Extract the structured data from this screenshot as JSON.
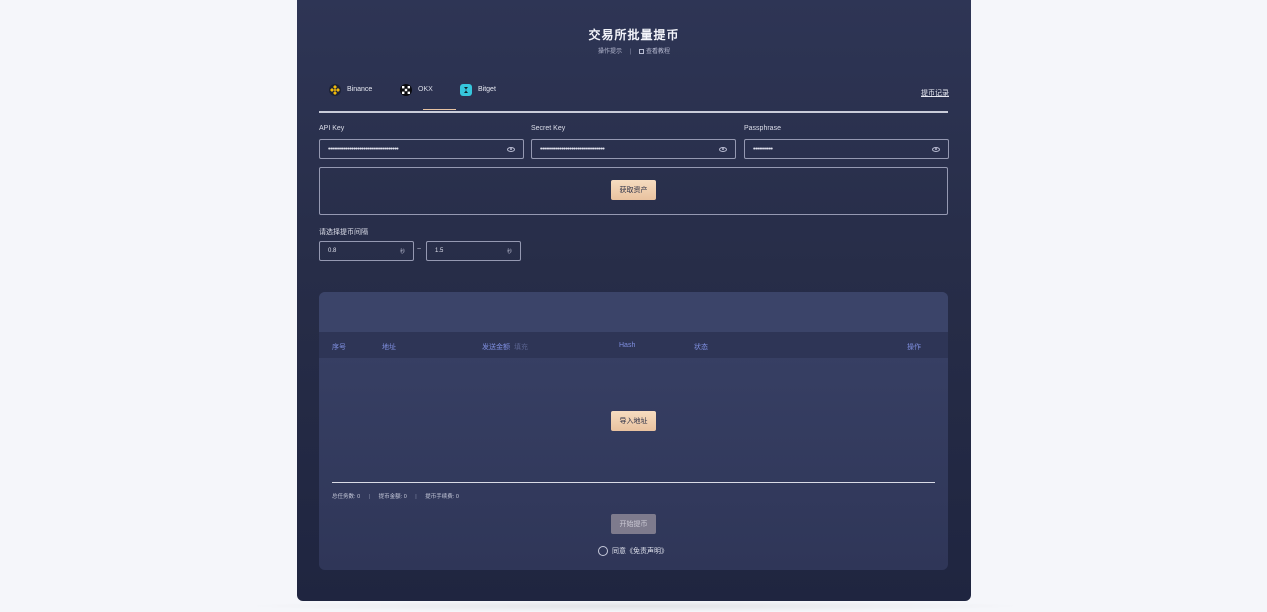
{
  "header": {
    "title": "交易所批量提币",
    "hint_link": "操作提示",
    "tutorial_link": "查看教程"
  },
  "tabs": [
    {
      "label": "Binance",
      "icon": "binance-icon",
      "color": "#f0b90b"
    },
    {
      "label": "OKX",
      "icon": "okx-icon",
      "color": "#000000"
    },
    {
      "label": "Bitget",
      "icon": "bitget-icon",
      "color": "#00c2d1"
    }
  ],
  "active_tab": "OKX",
  "record_link": "提币记录",
  "fields": {
    "api_key": {
      "label": "API Key",
      "value": "••••••••••••••••••••••••••••••••••••"
    },
    "secret_key": {
      "label": "Secret Key",
      "value": "•••••••••••••••••••••••••••••••••"
    },
    "passphrase": {
      "label": "Passphrase",
      "value": "••••••••••"
    }
  },
  "buttons": {
    "get_assets": "获取资产",
    "import_address": "导入地址",
    "start_withdraw": "开始提币"
  },
  "interval": {
    "label": "请选择提币间隔",
    "min": "0.8",
    "max": "1.5",
    "unit": "秒",
    "separator": "~"
  },
  "table": {
    "columns": [
      "序号",
      "地址",
      "发送金额",
      "Hash",
      "状态",
      "操作"
    ],
    "amount_hint": "填充"
  },
  "stats": {
    "total_tasks_label": "总任务数:",
    "total_tasks": "0",
    "withdraw_amount_label": "提币金额:",
    "withdraw_amount": "0",
    "fee_label": "提币手续费:",
    "fee": "0"
  },
  "agreement": "同意《免责声明》",
  "colors": {
    "accent_gold": "#e9c29f",
    "panel_bg": "#2a3150",
    "table_header_text": "#7f8fe0"
  }
}
